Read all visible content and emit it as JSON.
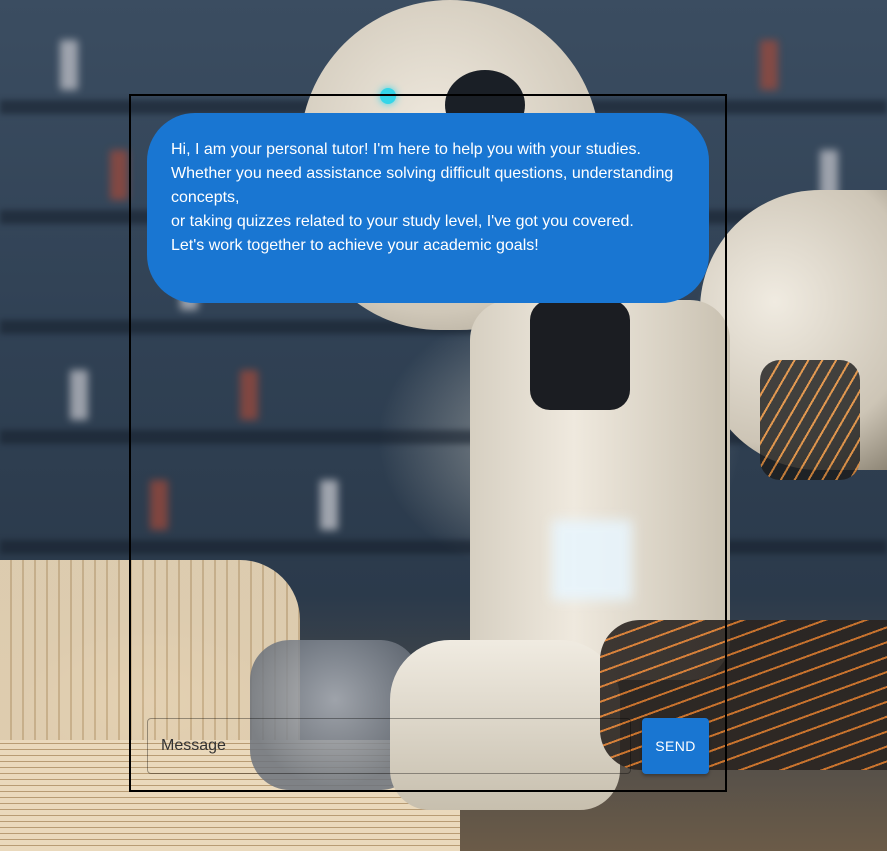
{
  "chat": {
    "tutor_message": "Hi, I am your personal tutor! I'm here to help you with your studies.\n      Whether you need assistance solving difficult questions, understanding concepts,\n      or taking quizzes related to your study level, I've got you covered.\n      Let's work together to achieve your academic goals!"
  },
  "composer": {
    "placeholder": "Message",
    "send_label": "SEND"
  },
  "theme": {
    "accent": "#1976d2",
    "frame_border": "#000000"
  }
}
